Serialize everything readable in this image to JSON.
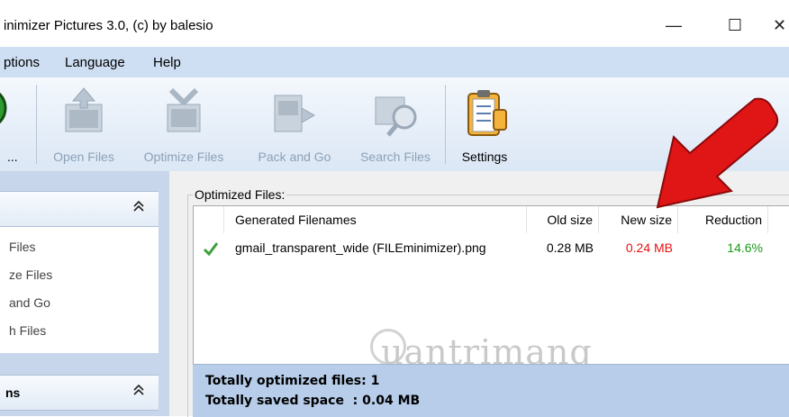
{
  "window": {
    "title": "inimizer Pictures 3.0, (c) by balesio",
    "minimize_glyph": "—",
    "maximize_glyph": "☐",
    "close_glyph": "✕"
  },
  "menu": [
    "ptions",
    "Language",
    "Help"
  ],
  "toolbar": {
    "first_label": "...",
    "items": [
      {
        "label": "Open Files",
        "icon": "open-files-icon",
        "enabled": false
      },
      {
        "label": "Optimize Files",
        "icon": "optimize-files-icon",
        "enabled": false
      },
      {
        "label": "Pack and Go",
        "icon": "pack-and-go-icon",
        "enabled": false
      },
      {
        "label": "Search Files",
        "icon": "search-files-icon",
        "enabled": false
      },
      {
        "label": "Settings",
        "icon": "settings-icon",
        "enabled": true
      }
    ]
  },
  "sidebar": {
    "panel1": {
      "title": "",
      "chevron": "≈",
      "links": [
        "Files",
        "ze Files",
        "and Go",
        "h Files"
      ]
    },
    "panel2": {
      "title": "ns",
      "chevron": "≈"
    }
  },
  "main": {
    "group_label": "Optimized Files:",
    "columns": [
      "Generated Filenames",
      "Old size",
      "New size",
      "Reduction"
    ],
    "rows": [
      {
        "status_icon": "check-icon",
        "filename": "gmail_transparent_wide (FILEminimizer).png",
        "old_size": "0.28 MB",
        "new_size": "0.24 MB",
        "reduction": "14.6%"
      }
    ],
    "summary": {
      "line1": "Totally optimized files: 1",
      "line2": "Totally saved space  : 0.04 MB"
    },
    "watermark": "uantrimang"
  },
  "colors": {
    "new_size": "#e81010",
    "reduction": "#1a9a1a",
    "check": "#3aa03a",
    "arrow": "#e01515"
  }
}
